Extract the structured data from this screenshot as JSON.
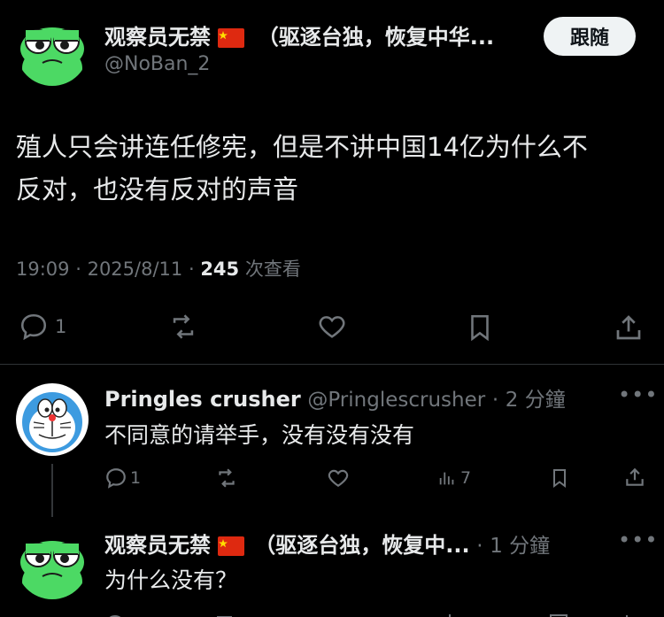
{
  "main_tweet": {
    "display_name": "观察员无禁",
    "name_suffix": "（驱逐台独，恢复中华...",
    "handle": "@NoBan_2",
    "follow_label": "跟随",
    "text_line1": "殖人只会讲连任修宪，但是不讲中国14亿为什么不",
    "text_line2": "反对，也没有反对的声音",
    "time": "19:09",
    "date": "2025/8/11",
    "views_count": "245",
    "views_label": "次查看",
    "reply_count": "1"
  },
  "reply1": {
    "display_name": "Pringles crusher",
    "handle": "@Pringlescrusher",
    "time_ago": "2 分鐘",
    "text": "不同意的请举手，没有没有没有",
    "reply_count": "1",
    "views_count": "7"
  },
  "reply2": {
    "display_name": "观察员无禁",
    "name_suffix": "（驱逐台独，恢复中...",
    "time_ago": "1 分鐘",
    "text": "为什么没有？"
  },
  "colors": {
    "background": "#000000",
    "text": "#e7e9ea",
    "muted": "#71767b",
    "divider": "#2f3336",
    "follow_bg": "#eff3f4",
    "frog_green": "#4cd964"
  }
}
